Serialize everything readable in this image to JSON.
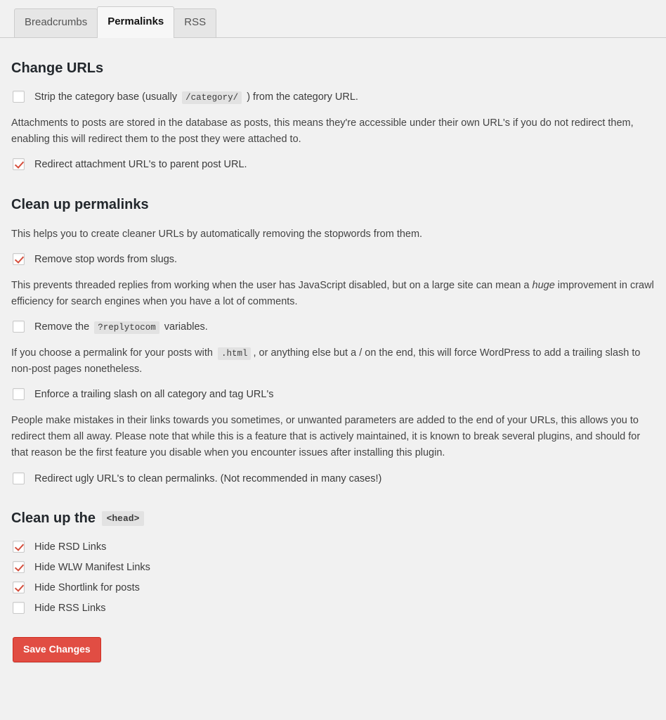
{
  "tabs": [
    {
      "label": "Breadcrumbs",
      "active": false
    },
    {
      "label": "Permalinks",
      "active": true
    },
    {
      "label": "RSS",
      "active": false
    }
  ],
  "sections": {
    "change_urls": {
      "title": "Change URLs",
      "strip_category": {
        "before": "Strip the category base (usually",
        "code": "/category/",
        "after": ") from the category URL.",
        "checked": false
      },
      "attachments_desc": "Attachments to posts are stored in the database as posts, this means they're accessible under their own URL's if you do not redirect them, enabling this will redirect them to the post they were attached to.",
      "redirect_attachment": {
        "label": "Redirect attachment URL's to parent post URL.",
        "checked": true
      }
    },
    "clean_permalinks": {
      "title": "Clean up permalinks",
      "stopwords_desc": "This helps you to create cleaner URLs by automatically removing the stopwords from them.",
      "remove_stop_words": {
        "label": "Remove stop words from slugs.",
        "checked": true
      },
      "replytocom_desc_1": "This prevents threaded replies from working when the user has JavaScript disabled, but on a large site can mean a ",
      "replytocom_desc_em": "huge",
      "replytocom_desc_2": " improvement in crawl efficiency for search engines when you have a lot of comments.",
      "remove_replytocom": {
        "before": "Remove the",
        "code": "?replytocom",
        "after": "variables.",
        "checked": false
      },
      "trailing_slash_desc_1": "If you choose a permalink for your posts with",
      "trailing_slash_code": ".html",
      "trailing_slash_desc_2": ", or anything else but a / on the end, this will force WordPress to add a trailing slash to non-post pages nonetheless.",
      "enforce_trailing_slash": {
        "label": "Enforce a trailing slash on all category and tag URL's",
        "checked": false
      },
      "ugly_urls_desc": "People make mistakes in their links towards you sometimes, or unwanted parameters are added to the end of your URLs, this allows you to redirect them all away. Please note that while this is a feature that is actively maintained, it is known to break several plugins, and should for that reason be the first feature you disable when you encounter issues after installing this plugin.",
      "redirect_ugly_urls": {
        "label": "Redirect ugly URL's to clean permalinks. (Not recommended in many cases!)",
        "checked": false
      }
    },
    "clean_head": {
      "title_text": "Clean up the",
      "title_code": "<head>",
      "options": [
        {
          "label": "Hide RSD Links",
          "checked": true
        },
        {
          "label": "Hide WLW Manifest Links",
          "checked": true
        },
        {
          "label": "Hide Shortlink for posts",
          "checked": true
        },
        {
          "label": "Hide RSS Links",
          "checked": false
        }
      ]
    }
  },
  "footer": {
    "save_label": "Save Changes"
  },
  "colors": {
    "accent_red": "#e14d43",
    "check_red": "#d54e3c",
    "page_bg": "#f1f1f1",
    "code_bg": "#e2e2e2"
  }
}
